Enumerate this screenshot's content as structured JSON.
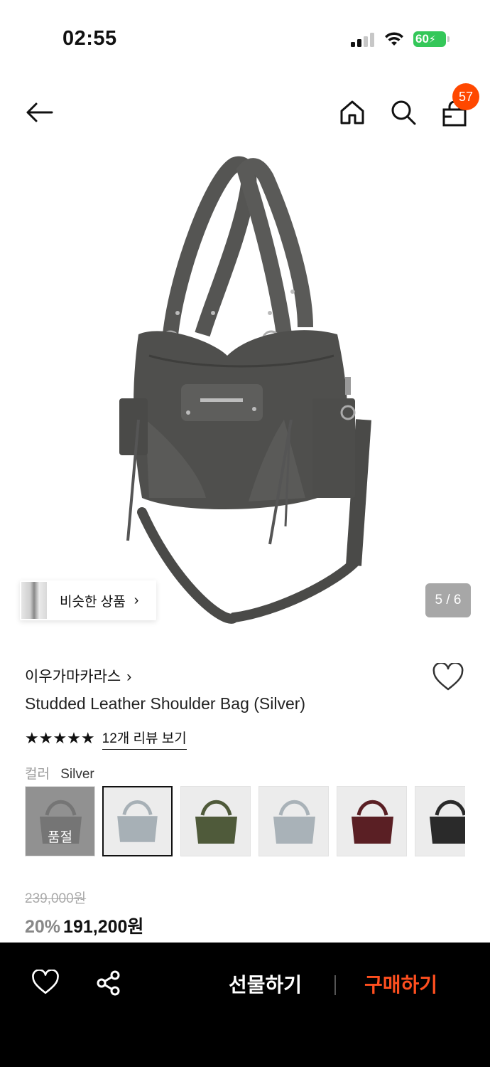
{
  "status": {
    "time": "02:55",
    "battery": "60"
  },
  "nav": {
    "cart_count": "57"
  },
  "gallery": {
    "similar_label": "비슷한 상품",
    "counter": "5 / 6"
  },
  "product": {
    "brand": "이우가마카라스",
    "title": "Studded Leather Shoulder Bag (Silver)",
    "stars": "★★★★★",
    "review_link": "12개 리뷰 보기",
    "color_label": "컬러",
    "color_value": "Silver",
    "swatches": [
      {
        "color": "#8a8a88",
        "soldout_label": "품절"
      },
      {
        "color": "#a7b0b6",
        "selected": true
      },
      {
        "color": "#4f5a3a"
      },
      {
        "color": "#a9b2b8"
      },
      {
        "color": "#5a1f24"
      },
      {
        "color": "#2a2a2a"
      }
    ],
    "original_price": "239,000원",
    "discount": "20%",
    "price": "191,200원"
  },
  "bottom": {
    "gift_label": "선물하기",
    "buy_label": "구매하기"
  },
  "colors": {
    "accent": "#ff4800",
    "buy": "#ff4f1f"
  }
}
